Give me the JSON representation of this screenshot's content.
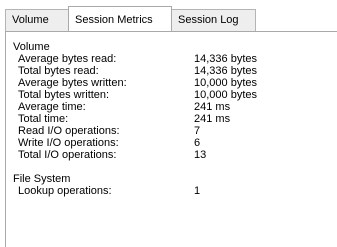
{
  "tabs": [
    {
      "label": "Volume",
      "active": false
    },
    {
      "label": "Session Metrics",
      "active": true
    },
    {
      "label": "Session Log",
      "active": false
    }
  ],
  "volume": {
    "title": "Volume",
    "rows": [
      {
        "label": "Average bytes read:",
        "value": "14,336 bytes"
      },
      {
        "label": "Total bytes read:",
        "value": "14,336 bytes"
      },
      {
        "label": "Average bytes written:",
        "value": "10,000 bytes"
      },
      {
        "label": "Total bytes written:",
        "value": "10,000 bytes"
      },
      {
        "label": "Average time:",
        "value": "241 ms"
      },
      {
        "label": "Total time:",
        "value": "241 ms"
      },
      {
        "label": "Read I/O operations:",
        "value": "7"
      },
      {
        "label": "Write I/O operations:",
        "value": "6"
      },
      {
        "label": "Total I/O operations:",
        "value": "13"
      }
    ]
  },
  "file_system": {
    "title": "File System",
    "rows": [
      {
        "label": "Lookup operations:",
        "value": "1"
      }
    ]
  }
}
